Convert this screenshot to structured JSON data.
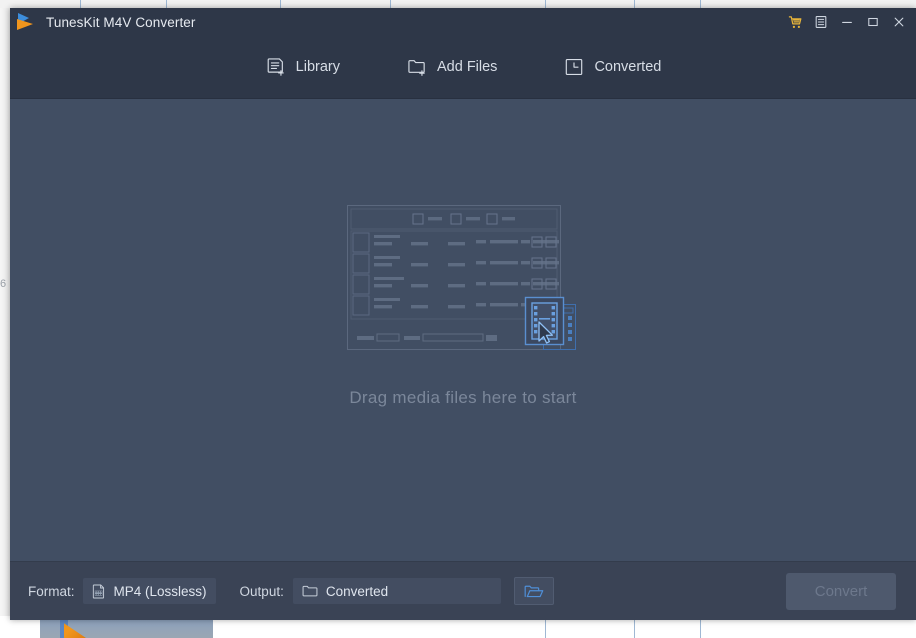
{
  "window": {
    "title": "TunesKit M4V Converter",
    "logo_icon": "tuneskit-logo-icon",
    "controls": [
      {
        "name": "cart-icon",
        "glyph": "cart",
        "label": "Buy"
      },
      {
        "name": "menu-icon",
        "glyph": "menu",
        "label": "Menu"
      },
      {
        "name": "minimize-icon",
        "glyph": "minimize",
        "label": "Minimize"
      },
      {
        "name": "maximize-icon",
        "glyph": "maximize",
        "label": "Maximize"
      },
      {
        "name": "close-icon",
        "glyph": "close",
        "label": "Close"
      }
    ]
  },
  "toolbar": {
    "items": [
      {
        "label": "Library",
        "icon": "library-add-icon"
      },
      {
        "label": "Add Files",
        "icon": "folder-add-icon"
      },
      {
        "label": "Converted",
        "icon": "converted-history-icon"
      }
    ]
  },
  "main": {
    "drop_hint": "Drag media files here to start",
    "illustration_icon": "drag-drop-illustration"
  },
  "bottom": {
    "format_label": "Format:",
    "format_icon": "video-file-icon",
    "format_value": "MP4 (Lossless)",
    "output_label": "Output:",
    "output_icon": "folder-outline-icon",
    "output_value": "Converted",
    "browse_icon": "open-folder-icon",
    "convert_label": "Convert"
  },
  "background": {
    "left_gutter_number": "6"
  },
  "colors": {
    "window_body": "#414e63",
    "titlebar": "#2e3748",
    "bottombar": "#3a4355",
    "accent_blue": "#4a7fc1",
    "accent_orange": "#f0951d",
    "text_primary": "#dfe5ee",
    "text_muted": "#7b879a",
    "convert_disabled_bg": "#4e596d"
  }
}
